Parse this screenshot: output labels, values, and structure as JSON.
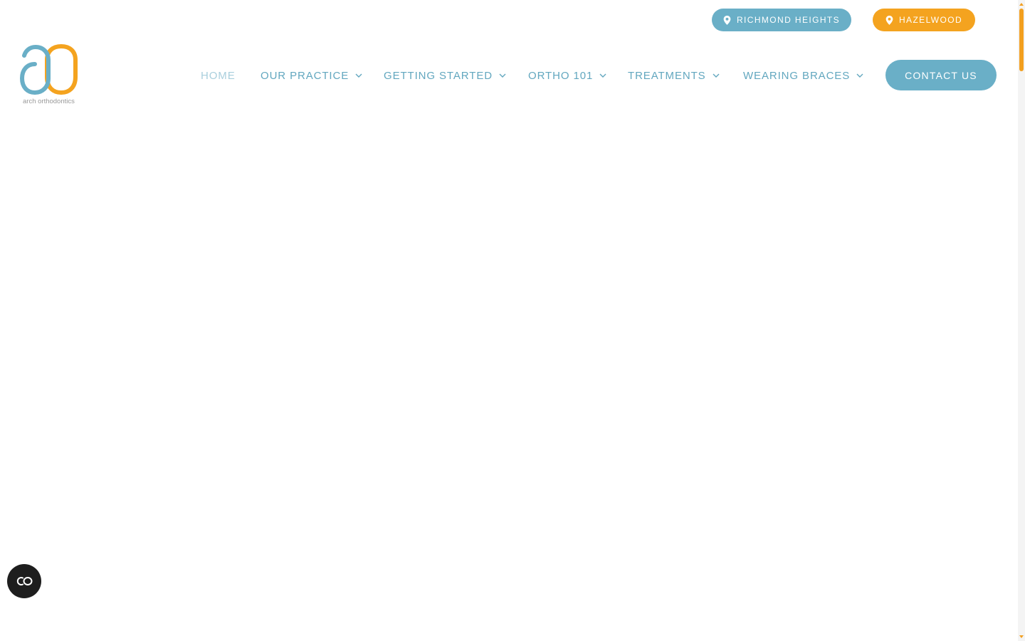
{
  "colors": {
    "blue": "#6aafc7",
    "orange": "#f4a31f",
    "home_inactive": "#a9cfdd",
    "nav_text": "#62a7bf",
    "dark_button": "#1e1e1e",
    "scroll_thumb": "#f29f1f"
  },
  "locations": [
    {
      "label": "RICHMOND HEIGHTS",
      "icon": "map-pin-icon",
      "color": "#6aafc7"
    },
    {
      "label": "HAZELWOOD",
      "icon": "map-pin-icon",
      "color": "#f4a31f"
    }
  ],
  "logo": {
    "text": "arch orthodontics"
  },
  "nav": {
    "items": [
      {
        "label": "HOME",
        "has_dropdown": false
      },
      {
        "label": "OUR PRACTICE",
        "has_dropdown": true
      },
      {
        "label": "GETTING STARTED",
        "has_dropdown": true
      },
      {
        "label": "ORTHO 101",
        "has_dropdown": true
      },
      {
        "label": "TREATMENTS",
        "has_dropdown": true
      },
      {
        "label": "WEARING BRACES",
        "has_dropdown": true
      }
    ],
    "contact_label": "CONTACT US"
  },
  "accessibility": {
    "icon": "accessibility-toggle-icon"
  }
}
